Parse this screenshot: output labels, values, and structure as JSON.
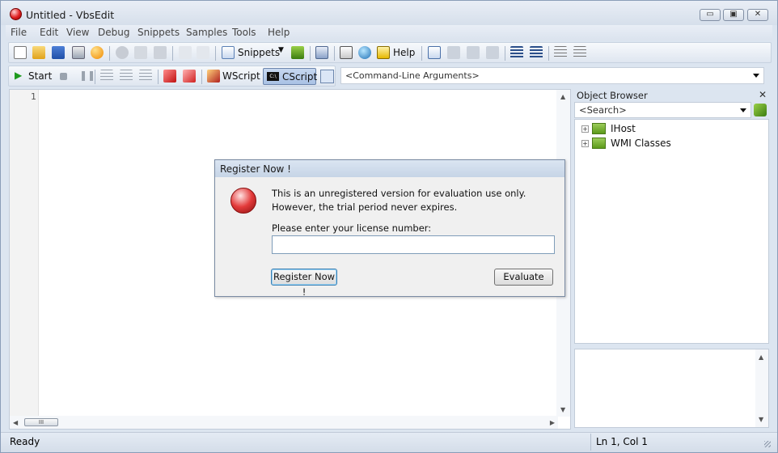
{
  "window": {
    "title": "Untitled - VbsEdit",
    "minimize_glyph": "▭",
    "maximize_glyph": "▣",
    "close_glyph": "✕"
  },
  "menu": [
    "File",
    "Edit",
    "View",
    "Debug",
    "Snippets",
    "Samples",
    "Tools",
    "Help"
  ],
  "toolbar": {
    "snippets_label": "Snippets",
    "help_label": "Help",
    "icons": [
      "new-file-icon",
      "open-folder-icon",
      "save-icon",
      "print-icon",
      "record-icon",
      "cut-icon",
      "copy-icon",
      "paste-icon",
      "undo-icon",
      "redo-icon",
      "snippets-icon",
      "add-snippet-icon",
      "insert-object-icon",
      "find-icon",
      "search-globe-icon",
      "help-icon",
      "comment-icon",
      "bookmark-icon",
      "bookmark-next-icon",
      "bookmark-clear-icon",
      "indent-icon",
      "outdent-icon",
      "align-icon",
      "format-icon"
    ]
  },
  "debugbar": {
    "start_label": "Start",
    "wscript_label": "WScript",
    "cscript_label": "CScript",
    "arguments_placeholder": "<Command-Line Arguments>"
  },
  "editor": {
    "line_numbers": [
      "1"
    ],
    "thumb_glyph": "III"
  },
  "object_browser": {
    "title": "Object Browser",
    "close_glyph": "✕",
    "search_value": "<Search>",
    "tree": [
      {
        "label": "IHost",
        "expander": "+"
      },
      {
        "label": "WMI Classes",
        "expander": "+"
      }
    ]
  },
  "dialog": {
    "title": "Register Now !",
    "message": "This is an unregistered version for evaluation use only. However, the trial period never expires.",
    "license_label": "Please enter your license number:",
    "license_value": "",
    "register_button": "Register Now !",
    "evaluate_button": "Evaluate"
  },
  "status": {
    "left": "Ready",
    "position": "Ln 1, Col 1"
  },
  "colors": {
    "accent_red": "#e02020",
    "panel_bg": "#dce5f0",
    "toolbar_bg": "#f7f9fc"
  }
}
